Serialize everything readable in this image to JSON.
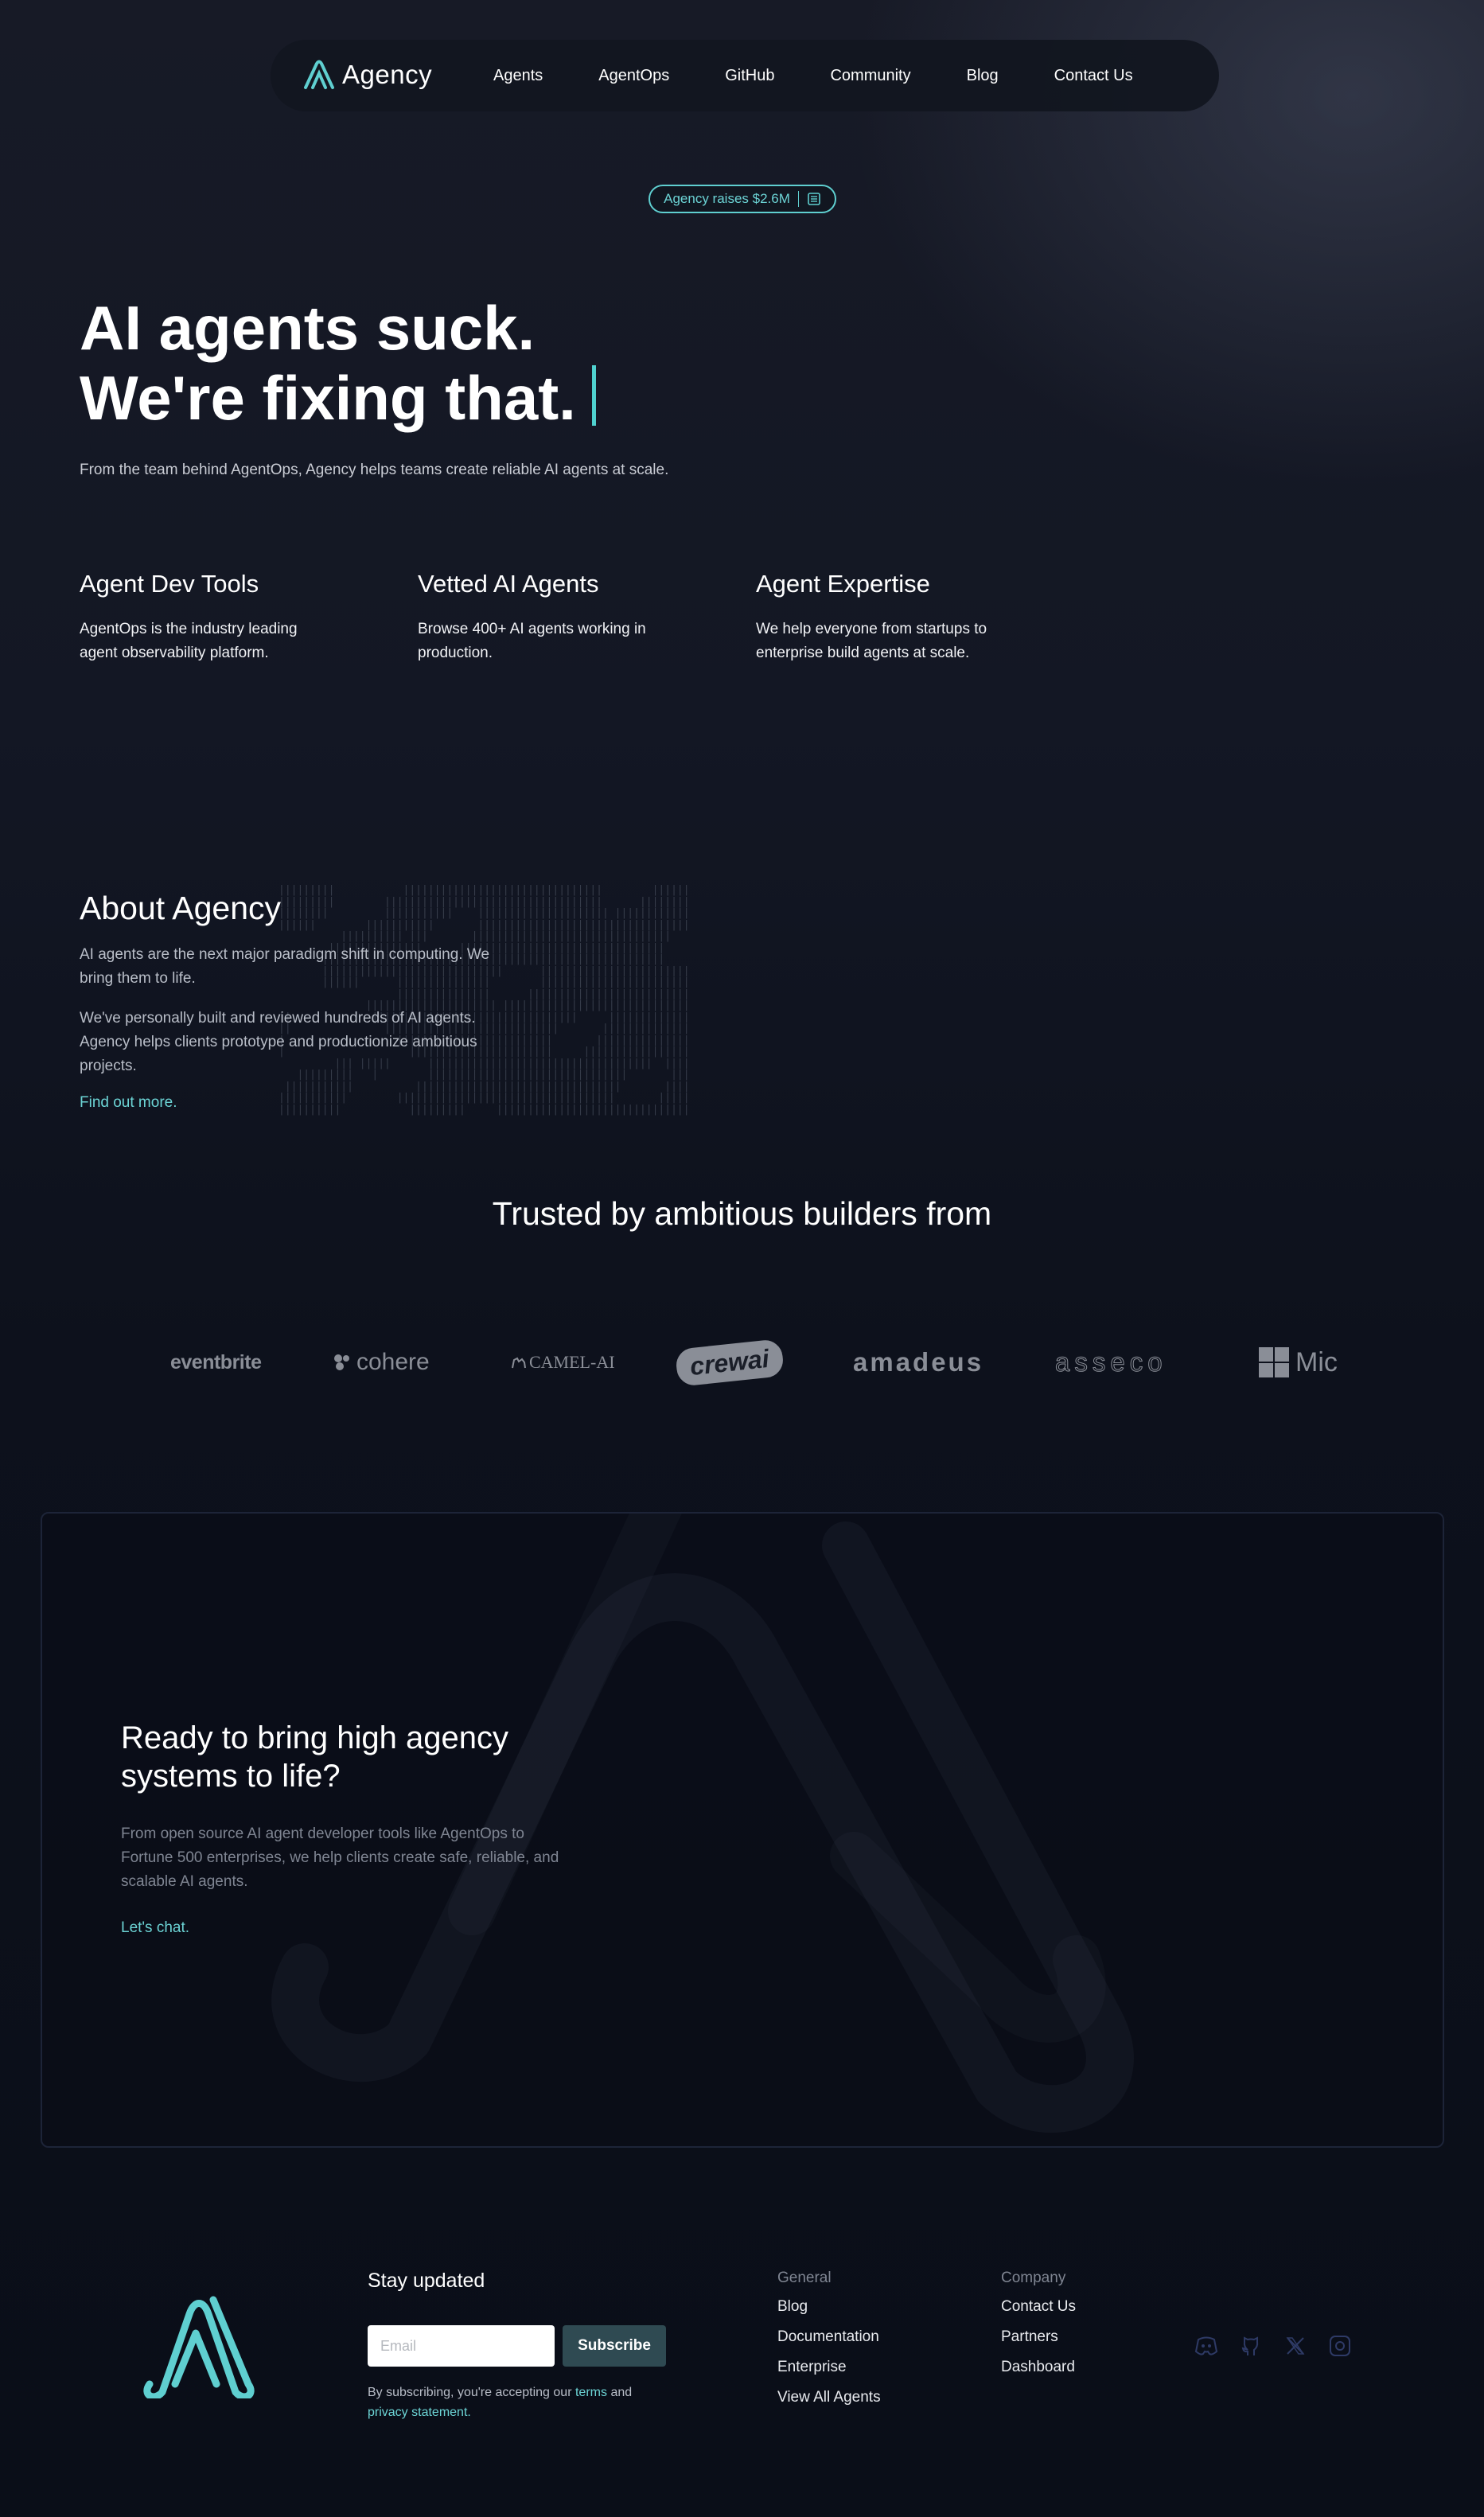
{
  "nav": {
    "brand": "Agency",
    "links": [
      "Agents",
      "AgentOps",
      "GitHub",
      "Community",
      "Blog",
      "Contact Us"
    ]
  },
  "badge": {
    "text": "Agency raises $2.6M"
  },
  "hero": {
    "title_line1": "AI agents suck.",
    "title_line2": "We're fixing that.",
    "subtitle": "From the team behind AgentOps, Agency helps teams create reliable AI agents at scale."
  },
  "features": [
    {
      "title": "Agent Dev Tools",
      "text": "AgentOps is the industry leading agent observability platform."
    },
    {
      "title": "Vetted AI Agents",
      "text": "Browse 400+ AI agents working in production."
    },
    {
      "title": "Agent Expertise",
      "text": "We help everyone from startups to enterprise build agents at scale."
    }
  ],
  "about": {
    "title": "About Agency",
    "p1": "AI agents are the next major paradigm shift in computing. We bring them to life.",
    "p2": "We've personally built and reviewed hundreds of AI agents. Agency helps clients prototype and productionize ambitious projects.",
    "link": "Find out more."
  },
  "trusted": {
    "title": "Trusted by ambitious builders from",
    "brands": [
      "eventbrite",
      "cohere",
      "CAMEL-AI",
      "crewai",
      "amadeus",
      "asseco",
      "Mic"
    ]
  },
  "cta": {
    "title": "Ready to bring high agency systems to life?",
    "text": "From open source AI agent developer tools like AgentOps to Fortune 500 enterprises, we help clients create safe, reliable, and scalable AI agents.",
    "link": "Let's chat."
  },
  "footer": {
    "stay_title": "Stay updated",
    "email_placeholder": "Email",
    "subscribe_label": "Subscribe",
    "legal_prefix": "By subscribing, you're accepting our",
    "legal_terms": "terms",
    "legal_and": "and",
    "legal_privacy": "privacy statement.",
    "general_title": "General",
    "general_links": [
      "Blog",
      "Documentation",
      "Enterprise",
      "View All Agents"
    ],
    "company_title": "Company",
    "company_links": [
      "Contact Us",
      "Partners",
      "Dashboard"
    ],
    "social_icons": [
      "discord-icon",
      "github-icon",
      "x-icon",
      "instagram-icon"
    ]
  },
  "colors": {
    "accent": "#5fcfd0",
    "background": "#0b0f1a",
    "button": "#2f4a52"
  }
}
